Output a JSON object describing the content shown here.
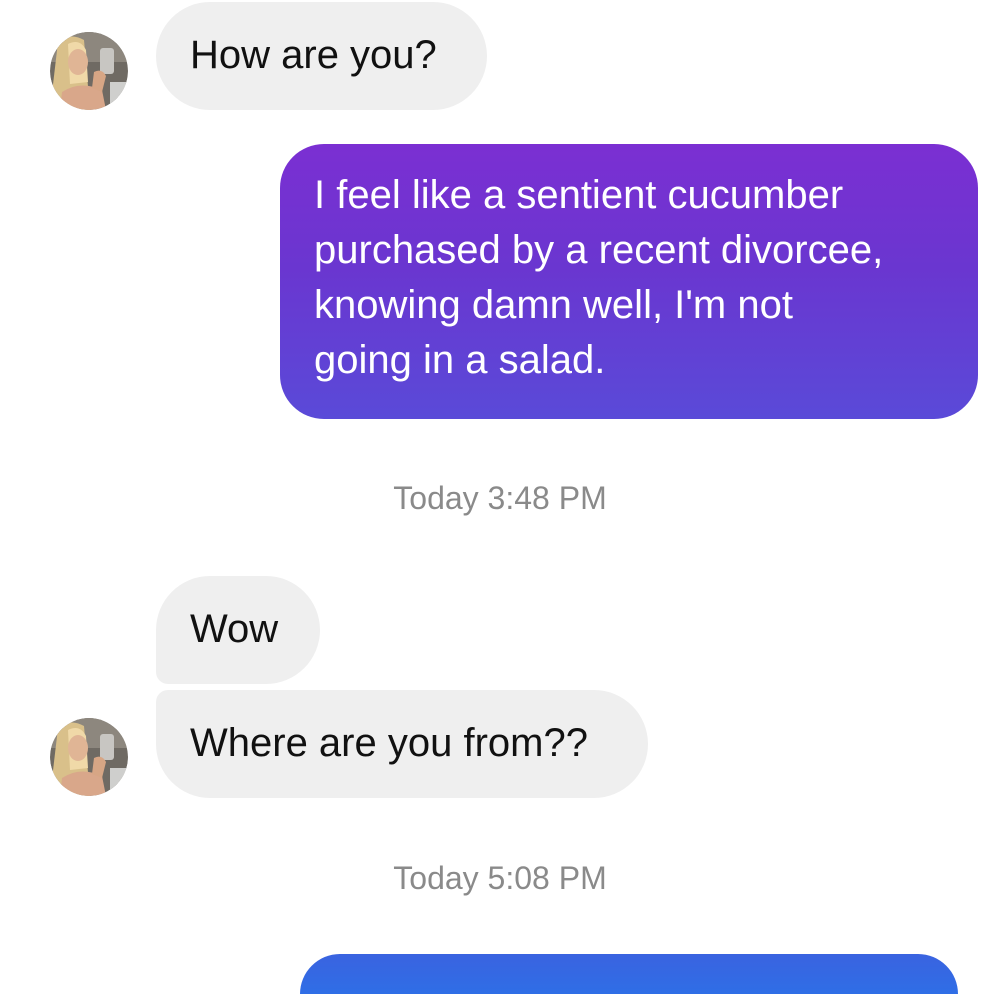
{
  "messages": [
    {
      "sender": "them",
      "text": "How are you?"
    },
    {
      "sender": "me",
      "text": "I feel like a sentient cucumber\npurchased by a recent divorcee,\nknowing damn well, I'm not\ngoing in a salad."
    },
    {
      "sender": "them",
      "text": "Wow"
    },
    {
      "sender": "them",
      "text": "Where are you from??"
    }
  ],
  "timestamps": [
    "Today 3:48 PM",
    "Today 5:08 PM"
  ],
  "colors": {
    "incoming_bubble": "#efefef",
    "outgoing_bubble_top": "#7b2fd2",
    "outgoing_bubble_bottom": "#5a4ad8",
    "outgoing_bubble_next": "#2f6ee6",
    "timestamp_text": "#8a8a8a"
  },
  "icons": {
    "avatar": "contact-avatar-photo"
  }
}
